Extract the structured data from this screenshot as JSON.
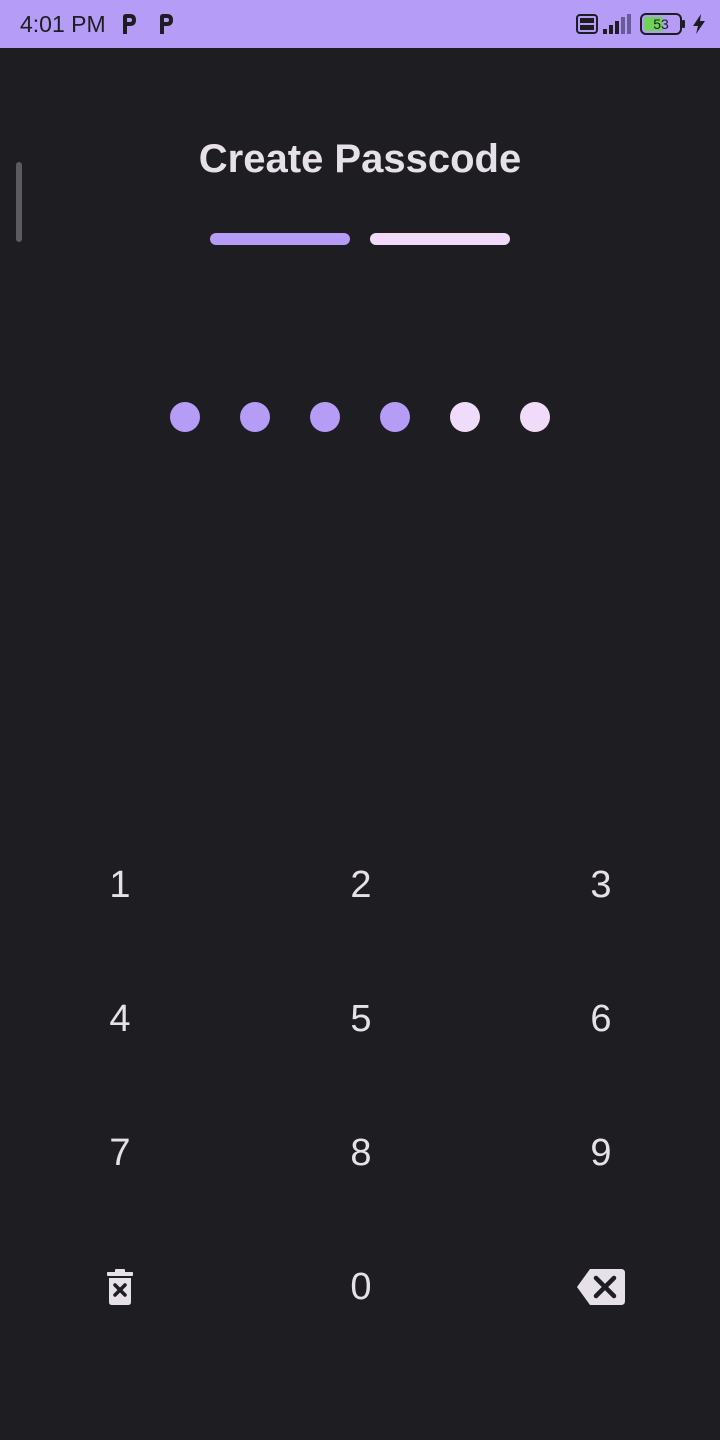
{
  "status_bar": {
    "time": "4:01 PM",
    "battery_level": "53",
    "notifications": [
      "p-app-icon",
      "p-app-icon"
    ]
  },
  "screen": {
    "title": "Create Passcode",
    "steps": {
      "total": 2,
      "current": 1
    },
    "passcode": {
      "length": 6,
      "entered": 4
    }
  },
  "keypad": {
    "rows": [
      [
        "1",
        "2",
        "3"
      ],
      [
        "4",
        "5",
        "6"
      ],
      [
        "7",
        "8",
        "9"
      ],
      [
        "clear-icon",
        "0",
        "backspace-icon"
      ]
    ]
  },
  "colors": {
    "background": "#1e1d22",
    "status_bar": "#b59cf7",
    "accent": "#b59cf7",
    "inactive": "#f0dcfa",
    "text": "#e6e1e8"
  }
}
